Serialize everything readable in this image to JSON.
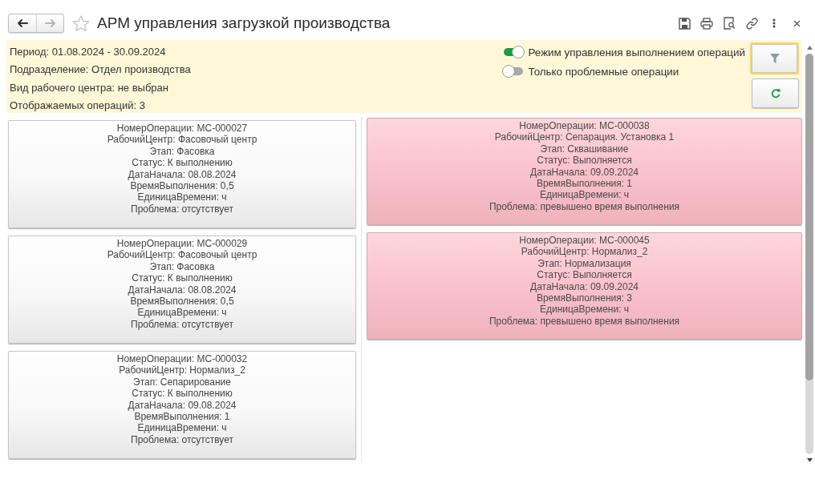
{
  "window": {
    "title": "АРМ управления загрузкой производства",
    "nav": [
      {
        "kind": "back",
        "disabled": false
      },
      {
        "kind": "forward",
        "disabled": true
      }
    ],
    "favorite": false
  },
  "header": {
    "info": [
      "Период: 01.08.2024 - 30.09.2024",
      "Подразделение: Отдел производства",
      "Вид рабочего центра: не выбран",
      "Отображаемых операций: 3"
    ],
    "toggles": [
      {
        "label": "Режим управления выполнением операций",
        "on": true
      },
      {
        "label": "Только проблемные операции",
        "on": false
      }
    ],
    "buttons": [
      {
        "kind": "filter",
        "focused": true
      },
      {
        "kind": "refresh",
        "focused": false
      }
    ]
  },
  "columns": [
    [
      {
        "problem": false,
        "lines": [
          "НомерОперации: МС-000027",
          "РабочийЦентр: Фасовочый центр",
          "Этап: Фасовка",
          "Статус: К выполнению",
          "ДатаНачала: 08.08.2024",
          "ВремяВыполнения: 0,5",
          "ЕдиницаВремени: ч",
          "Проблема: отсутствует"
        ]
      },
      {
        "problem": false,
        "lines": [
          "НомерОперации: МС-000029",
          "РабочийЦентр: Фасовочый центр",
          "Этап: Фасовка",
          "Статус: К выполнению",
          "ДатаНачала: 08.08.2024",
          "ВремяВыполнения: 0,5",
          "ЕдиницаВремени: ч",
          "Проблема: отсутствует"
        ]
      },
      {
        "problem": false,
        "lines": [
          "НомерОперации: МС-000032",
          "РабочийЦентр: Нормализ_2",
          "Этап: Сепарирование",
          "Статус: К выполнению",
          "ДатаНачала: 09.08.2024",
          "ВремяВыполнения: 1",
          "ЕдиницаВремени: ч",
          "Проблема: отсутствует"
        ]
      }
    ],
    [
      {
        "problem": true,
        "lines": [
          "НомерОперации: МС-000038",
          "РабочийЦентр: Сепарация. Установка 1",
          "Этап: Сквашивание",
          "Статус: Выполняется",
          "ДатаНачала: 09.09.2024",
          "ВремяВыполнения: 1",
          "ЕдиницаВремени: ч",
          "Проблема: превышено время выполнения"
        ]
      },
      {
        "problem": true,
        "lines": [
          "НомерОперации: МС-000045",
          "РабочийЦентр: Нормализ_2",
          "Этап: Нормализация",
          "Статус: Выполняется",
          "ДатаНачала: 09.09.2024",
          "ВремяВыполнения: 3",
          "ЕдиницаВремени: ч",
          "Проблема: превышено время выполнения"
        ]
      }
    ]
  ]
}
